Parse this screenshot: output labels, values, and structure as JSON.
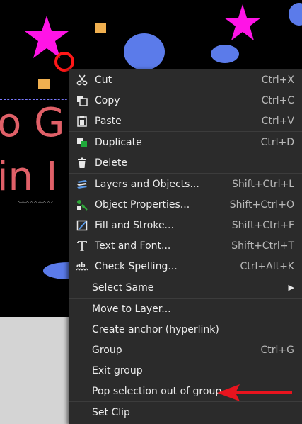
{
  "canvas": {
    "text_line1": "o G",
    "text_line2": "in I"
  },
  "menu": {
    "items": [
      {
        "label": "Cut",
        "shortcut": "Ctrl+X",
        "icon": "scissors-icon"
      },
      {
        "label": "Copy",
        "shortcut": "Ctrl+C",
        "icon": "copy-icon"
      },
      {
        "label": "Paste",
        "shortcut": "Ctrl+V",
        "icon": "paste-icon"
      },
      {
        "label": "Duplicate",
        "shortcut": "Ctrl+D",
        "icon": "duplicate-icon"
      },
      {
        "label": "Delete",
        "shortcut": "",
        "icon": "trash-icon"
      },
      {
        "label": "Layers and Objects...",
        "shortcut": "Shift+Ctrl+L",
        "icon": "layers-icon"
      },
      {
        "label": "Object Properties...",
        "shortcut": "Shift+Ctrl+O",
        "icon": "object-properties-icon"
      },
      {
        "label": "Fill and Stroke...",
        "shortcut": "Shift+Ctrl+F",
        "icon": "fill-stroke-icon"
      },
      {
        "label": "Text and Font...",
        "shortcut": "Shift+Ctrl+T",
        "icon": "text-icon"
      },
      {
        "label": "Check Spelling...",
        "shortcut": "Ctrl+Alt+K",
        "icon": "spellcheck-icon"
      },
      {
        "label": "Select Same",
        "shortcut": "",
        "icon": ""
      },
      {
        "label": "Move to Layer...",
        "shortcut": "",
        "icon": ""
      },
      {
        "label": "Create anchor (hyperlink)",
        "shortcut": "",
        "icon": ""
      },
      {
        "label": "Group",
        "shortcut": "Ctrl+G",
        "icon": ""
      },
      {
        "label": "Exit group",
        "shortcut": "",
        "icon": ""
      },
      {
        "label": "Pop selection out of group",
        "shortcut": "",
        "icon": ""
      },
      {
        "label": "Set Clip",
        "shortcut": "",
        "icon": ""
      }
    ]
  },
  "colors": {
    "accent_arrow": "#e8141e",
    "menu_bg": "#2b2b2b",
    "canvas_text": "#e06068"
  }
}
